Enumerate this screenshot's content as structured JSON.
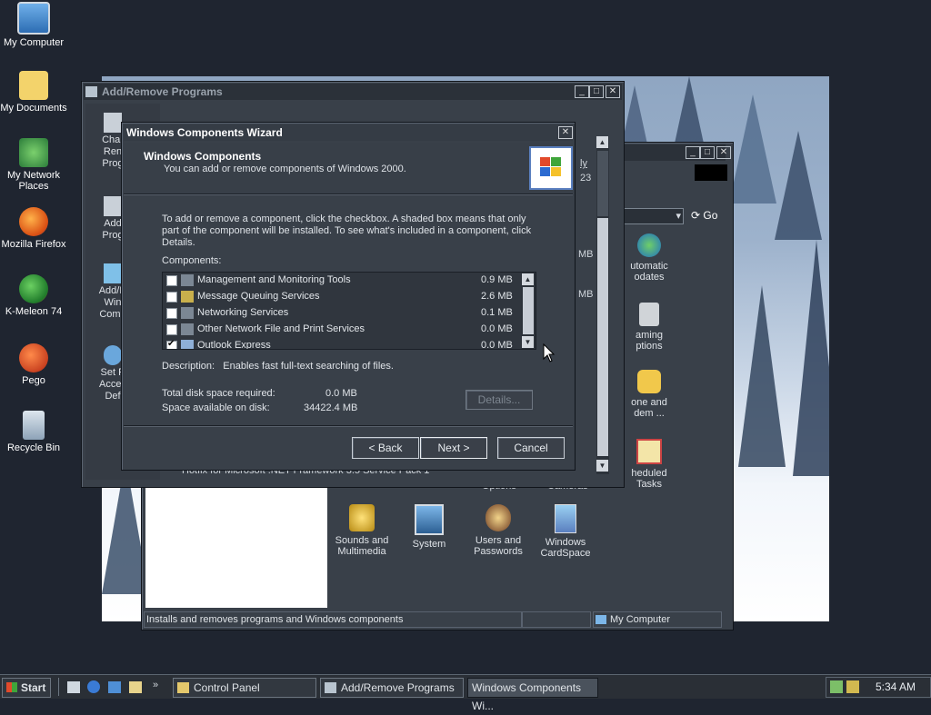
{
  "desktop_icons": [
    {
      "label": "My Computer"
    },
    {
      "label": "My Documents"
    },
    {
      "label": "My Network Places"
    },
    {
      "label": "Mozilla Firefox"
    },
    {
      "label": "K-Meleon 74"
    },
    {
      "label": "Pego"
    },
    {
      "label": "Recycle Bin"
    }
  ],
  "control_panel": {
    "go_label": "Go",
    "items": [
      {
        "label": "utomatic odates"
      },
      {
        "label": "aming ptions"
      },
      {
        "label": "one and dem ..."
      },
      {
        "label": "heduled Tasks"
      },
      {
        "label": "Sounds and Multimedia"
      },
      {
        "label": "System"
      },
      {
        "label": "Users and Passwords"
      },
      {
        "label": "Windows CardSpace"
      }
    ],
    "partial_labels": [
      "Options",
      "Cameras"
    ],
    "status_left": "Installs and removes programs and Windows components",
    "status_right": "My Computer"
  },
  "add_remove": {
    "title": "Add/Remove Programs",
    "sidebar": [
      {
        "label": "Char Ren Prog"
      },
      {
        "label": "Add Prog"
      },
      {
        "label": "Add/R Win Comp"
      },
      {
        "label": "Set P Acces Def"
      }
    ],
    "fragments": {
      "sizes_mb_1": "MB",
      "sizes_mb_2": "MB",
      "link_ly": "ly",
      "link_23": "23",
      "bottom_text": "Hotfix for Microsoft .NET Framework 3.5 Service Pack 1"
    }
  },
  "wizard": {
    "title": "Windows Components Wizard",
    "header_title": "Windows Components",
    "header_subtitle": "You can add or remove components of Windows 2000.",
    "instructions": "To add or remove a component, click the checkbox.  A shaded box means that only part of the component will be installed.  To see what's included in a component, click Details.",
    "components_label": "Components:",
    "components": [
      {
        "name": "Management and Monitoring Tools",
        "size": "0.9 MB",
        "checked": false
      },
      {
        "name": "Message Queuing Services",
        "size": "2.6 MB",
        "checked": false
      },
      {
        "name": "Networking Services",
        "size": "0.1 MB",
        "checked": false
      },
      {
        "name": "Other Network File and Print Services",
        "size": "0.0 MB",
        "checked": false
      },
      {
        "name": "Outlook Express",
        "size": "0.0 MB",
        "checked": true
      }
    ],
    "description_label": "Description:",
    "description": "Enables fast full-text searching of files.",
    "disk_required_label": "Total disk space required:",
    "disk_required": "0.0 MB",
    "space_available_label": "Space available on disk:",
    "space_available": "34422.4 MB",
    "details_label": "Details...",
    "back_label": "< Back",
    "next_label": "Next >",
    "cancel_label": "Cancel"
  },
  "taskbar": {
    "start_label": "Start",
    "tasks": [
      {
        "label": "Control Panel",
        "active": false
      },
      {
        "label": "Add/Remove Programs",
        "active": false
      },
      {
        "label": "Windows Components Wi...",
        "active": true
      }
    ],
    "clock": "5:34 AM"
  }
}
